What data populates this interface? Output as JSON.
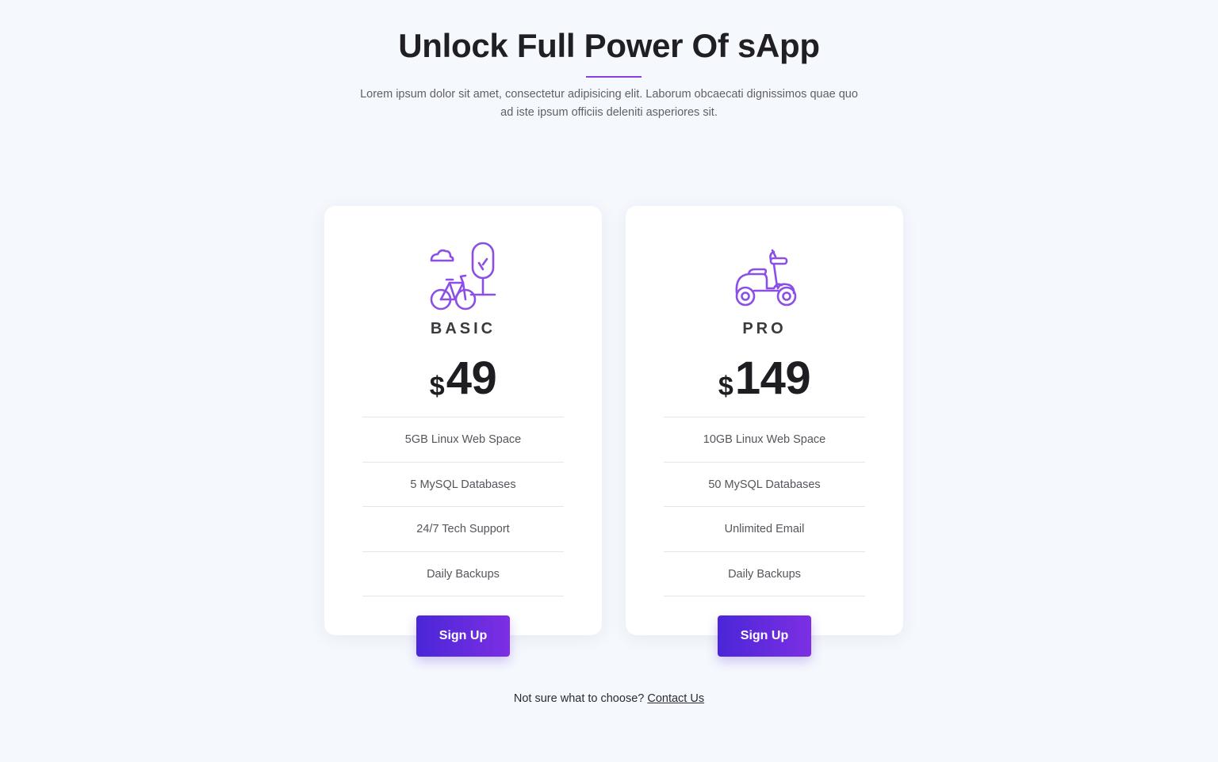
{
  "header": {
    "title": "Unlock Full Power Of sApp",
    "subtitle": "Lorem ipsum dolor sit amet, consectetur adipisicing elit. Laborum obcaecati dignissimos quae quo ad iste ipsum officiis deleniti asperiores sit."
  },
  "plans": [
    {
      "name": "BASIC",
      "icon": "bicycle-tree-icon",
      "currency": "$",
      "price": "49",
      "features": [
        "5GB Linux Web Space",
        "5 MySQL Databases",
        "24/7 Tech Support",
        "Daily Backups"
      ],
      "button_label": "Sign Up"
    },
    {
      "name": "PRO",
      "icon": "scooter-icon",
      "currency": "$",
      "price": "149",
      "features": [
        "10GB Linux Web Space",
        "50 MySQL Databases",
        "Unlimited Email",
        "Daily Backups"
      ],
      "button_label": "Sign Up"
    }
  ],
  "footer": {
    "question": "Not sure what to choose?",
    "contact_link": "Contact Us"
  },
  "colors": {
    "accent": "#7d2fe3",
    "accent_start": "#4a26d8",
    "icon_stroke": "#8b4fe6",
    "background": "#f5f8fd"
  }
}
